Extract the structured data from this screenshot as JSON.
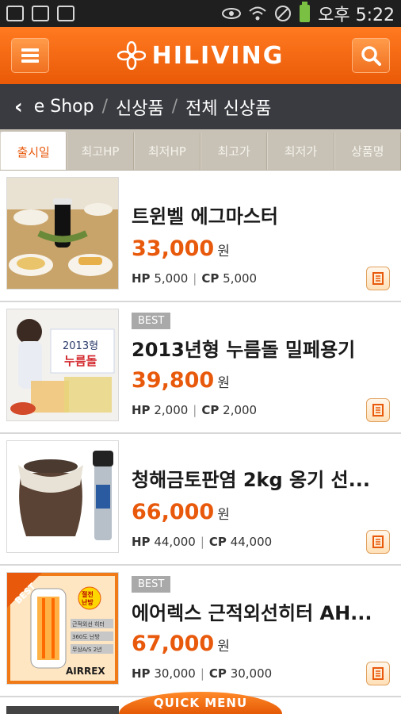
{
  "status_bar": {
    "time": "오후 5:22"
  },
  "header": {
    "brand": "HILIVING"
  },
  "breadcrumb": [
    "e Shop",
    "신상품",
    "전체 신상품"
  ],
  "sort_tabs": [
    "출시일",
    "최고HP",
    "최저HP",
    "최고가",
    "최저가",
    "상품명"
  ],
  "products": [
    {
      "title": "트윈벨 에그마스터",
      "badge": "",
      "price": "33,000",
      "hp": "5,000",
      "cp": "5,000"
    },
    {
      "title": "2013년형 누름돌 밀페용기",
      "badge": "BEST",
      "price": "39,800",
      "hp": "2,000",
      "cp": "2,000"
    },
    {
      "title": "청해금토판염 2kg 옹기 선...",
      "badge": "",
      "price": "66,000",
      "hp": "44,000",
      "cp": "44,000"
    },
    {
      "title": "에어렉스 근적외선히터 AH...",
      "badge": "BEST",
      "price": "67,000",
      "hp": "30,000",
      "cp": "30,000"
    }
  ],
  "labels": {
    "won": "원",
    "hp": "HP",
    "cp": "CP",
    "pipe": "|"
  },
  "quick_menu": "QUICK MENU",
  "thumb_text": {
    "p2_year": "2013형",
    "p2_name": "누름돌",
    "p4_best": "BEST",
    "p4_badge1": "절전",
    "p4_badge2": "난방",
    "p4_f1": "근적외선 히터",
    "p4_f2": "360도 난방",
    "p4_f3": "무상A/S 2년",
    "p4_brand": "AIRREX"
  },
  "colors": {
    "accent": "#e8590c",
    "header": "#f26b12",
    "breadcrumb_bg": "#393b40",
    "tabs_bg": "#c8c2b6"
  }
}
